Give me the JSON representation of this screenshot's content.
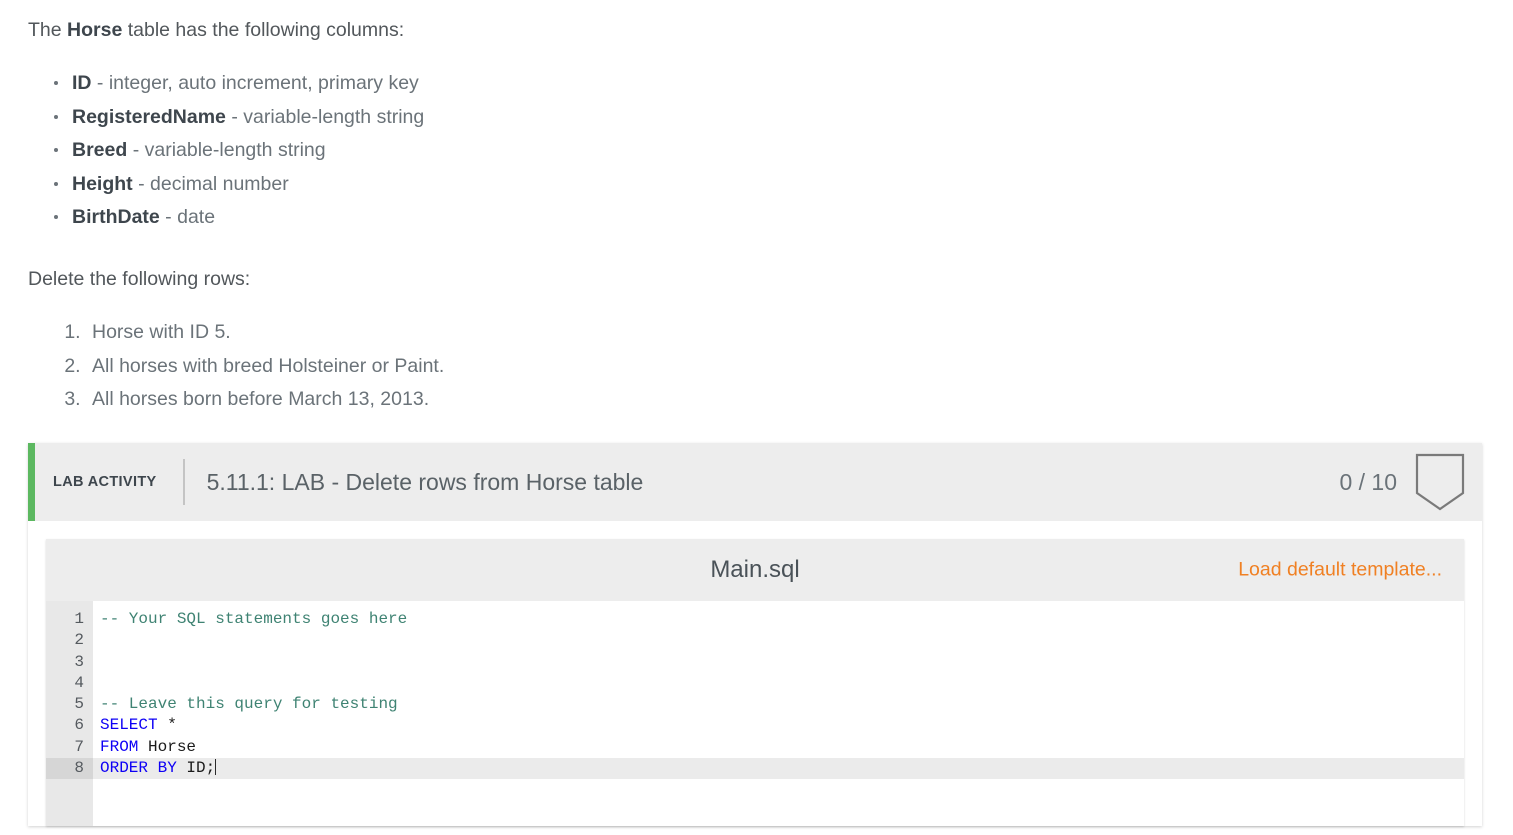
{
  "description": {
    "intro_prefix": "The ",
    "intro_bold": "Horse",
    "intro_suffix": " table has the following columns:",
    "columns": [
      {
        "name": "ID",
        "desc": " - integer, auto increment, primary key"
      },
      {
        "name": "RegisteredName",
        "desc": " - variable-length string"
      },
      {
        "name": "Breed",
        "desc": " - variable-length string"
      },
      {
        "name": "Height",
        "desc": " - decimal number"
      },
      {
        "name": "BirthDate",
        "desc": " - date"
      }
    ],
    "delete_lead": "Delete the following rows:",
    "delete_items": [
      "Horse with ID 5.",
      "All horses with breed Holsteiner or Paint.",
      "All horses born before March 13, 2013."
    ]
  },
  "lab": {
    "tag": "LAB ACTIVITY",
    "title": "5.11.1: LAB - Delete rows from Horse table",
    "score": "0 / 10",
    "bookmark_icon": "bookmark-pentagon-icon",
    "accent_color": "#5cb860"
  },
  "editor": {
    "file_name": "Main.sql",
    "load_template_label": "Load default template...",
    "load_template_color": "#f08023",
    "active_line": 8,
    "line_numbers": [
      "1",
      "2",
      "3",
      "4",
      "5",
      "6",
      "7",
      "8"
    ],
    "lines": [
      {
        "n": 1,
        "tokens": [
          {
            "t": "-- Your SQL statements goes here",
            "c": "comment"
          }
        ]
      },
      {
        "n": 2,
        "tokens": [
          {
            "t": "",
            "c": "plain"
          }
        ]
      },
      {
        "n": 3,
        "tokens": [
          {
            "t": "",
            "c": "plain"
          }
        ]
      },
      {
        "n": 4,
        "tokens": [
          {
            "t": "",
            "c": "plain"
          }
        ]
      },
      {
        "n": 5,
        "tokens": [
          {
            "t": "-- Leave this query for testing",
            "c": "comment"
          }
        ]
      },
      {
        "n": 6,
        "tokens": [
          {
            "t": "SELECT",
            "c": "keyword"
          },
          {
            "t": " *",
            "c": "plain"
          }
        ]
      },
      {
        "n": 7,
        "tokens": [
          {
            "t": "FROM",
            "c": "keyword"
          },
          {
            "t": " Horse",
            "c": "plain"
          }
        ]
      },
      {
        "n": 8,
        "tokens": [
          {
            "t": "ORDER BY",
            "c": "keyword"
          },
          {
            "t": " ID;",
            "c": "plain"
          }
        ]
      }
    ],
    "syntax_colors": {
      "comment": "#3f8373",
      "keyword": "#0e00f5",
      "plain": "#1a1a1a",
      "gutter_bg": "#e8e8e8",
      "active_line_bg": "#ebebeb"
    }
  }
}
